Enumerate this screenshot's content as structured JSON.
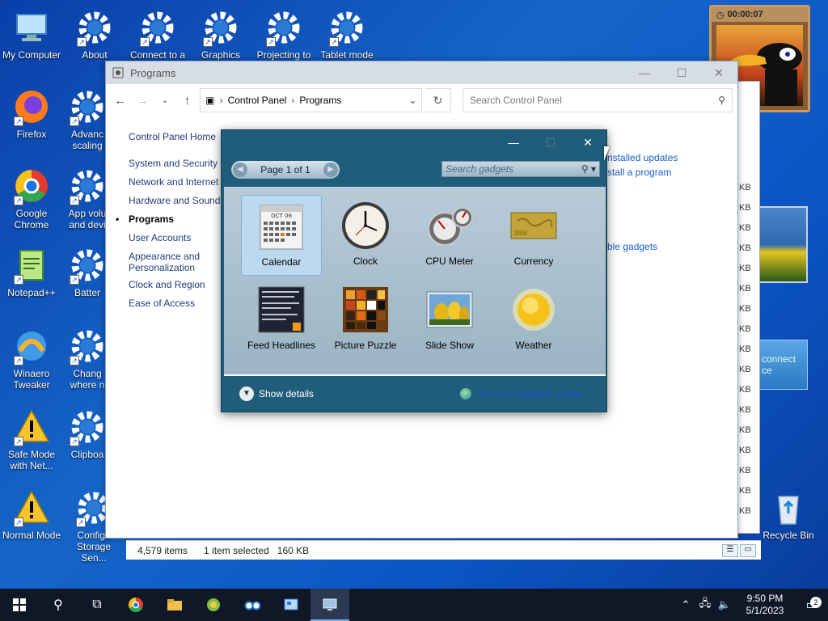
{
  "desktop": {
    "icons": [
      {
        "label": "My Computer",
        "icon": "computer-icon"
      },
      {
        "label": "About",
        "icon": "gear-icon"
      },
      {
        "label": "Connect to a",
        "icon": "gear-icon"
      },
      {
        "label": "Graphics",
        "icon": "gear-icon"
      },
      {
        "label": "Projecting to",
        "icon": "gear-icon"
      },
      {
        "label": "Tablet mode",
        "icon": "gear-icon"
      },
      {
        "label": "Firefox",
        "icon": "firefox-icon"
      },
      {
        "label": "Advanc scaling",
        "icon": "gear-icon"
      },
      {
        "label": "Google Chrome",
        "icon": "chrome-icon"
      },
      {
        "label": "App volu and devi",
        "icon": "gear-icon"
      },
      {
        "label": "Notepad++",
        "icon": "notepad-icon"
      },
      {
        "label": "Batter",
        "icon": "gear-icon"
      },
      {
        "label": "Winaero Tweaker",
        "icon": "winaero-icon"
      },
      {
        "label": "Chang where n",
        "icon": "gear-icon"
      },
      {
        "label": "Safe Mode with Net...",
        "icon": "warning-icon"
      },
      {
        "label": "Clipboa",
        "icon": "gear-icon"
      },
      {
        "label": "Normal Mode",
        "icon": "warning-icon"
      },
      {
        "label": "Configu Storage Sen...",
        "icon": "gear-icon"
      },
      {
        "label": "Recycle Bin",
        "icon": "recycle-bin-icon"
      }
    ],
    "photo_gadget": {
      "timer": "00:00:07"
    },
    "connect_tile": "connect ce"
  },
  "explorer": {
    "title": "Programs",
    "address": [
      "Control Panel",
      "Programs"
    ],
    "search_placeholder": "Search Control Panel",
    "nav": {
      "home": "Control Panel Home",
      "items": [
        "System and Security",
        "Network and Internet",
        "Hardware and Sound",
        "Programs",
        "User Accounts",
        "Appearance and Personalization",
        "Clock and Region",
        "Ease of Access"
      ]
    },
    "links": [
      "nstalled updates",
      "stall a program"
    ],
    "links2": "ble gadgets",
    "status": {
      "items": "4,579 items",
      "selected": "1 item selected",
      "size": "160 KB"
    },
    "kb_label": "KB"
  },
  "gadgets": {
    "page": "Page 1 of 1",
    "search_placeholder": "Search gadgets",
    "items": [
      "Calendar",
      "Clock",
      "CPU Meter",
      "Currency",
      "Feed Headlines",
      "Picture Puzzle",
      "Slide Show",
      "Weather"
    ],
    "calendar_month": "OCT 06",
    "show_details": "Show details",
    "online": "Get more gadgets online"
  },
  "taskbar": {
    "time": "9:50 PM",
    "date": "5/1/2023",
    "notifications": "2"
  },
  "colors": {
    "accent": "#1a5fc7",
    "gadget_bg": "#1f5d7a",
    "taskbar": "#101827"
  }
}
